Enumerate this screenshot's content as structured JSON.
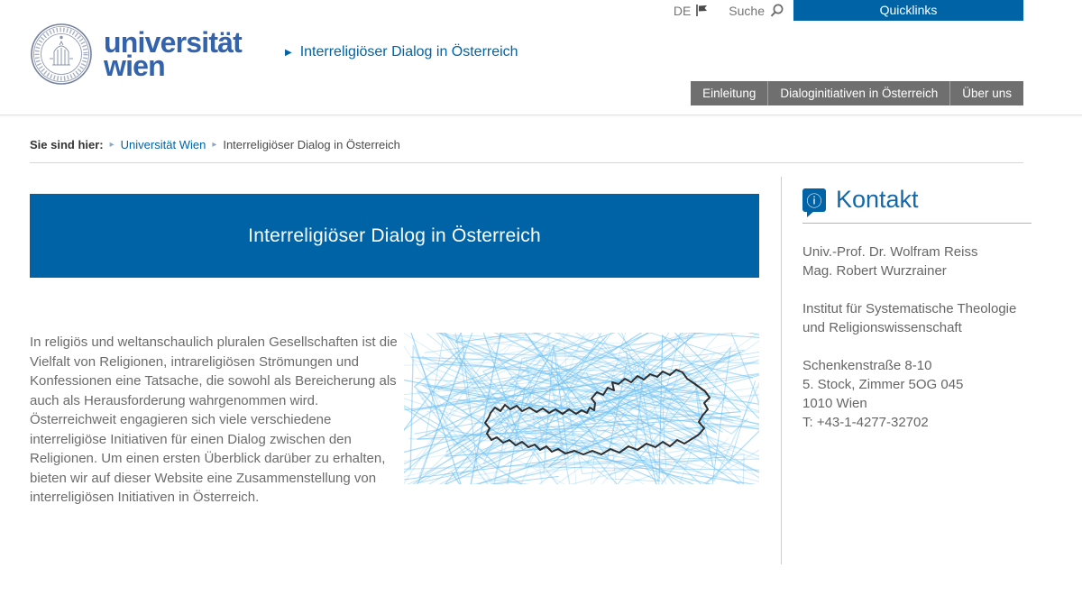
{
  "topbar": {
    "language": "DE",
    "search_label": "Suche",
    "quicklinks_label": "Quicklinks"
  },
  "header": {
    "logo": {
      "line1": "universität",
      "line2": "wien"
    },
    "site_title": "Interreligiöser Dialog in Österreich",
    "nav": [
      "Einleitung",
      "Dialoginitiativen in Österreich",
      "Über uns"
    ]
  },
  "breadcrumb": {
    "label": "Sie sind hier:",
    "items": [
      {
        "label": "Universität Wien"
      },
      {
        "label": "Interreligiöser Dialog in Österreich"
      }
    ]
  },
  "main": {
    "banner_title": "Interreligiöser Dialog in Österreich",
    "paragraph": "In religiös und weltanschaulich pluralen Gesellschaften ist die Vielfalt von Religionen, intrareligiösen Strömungen und Konfessionen eine Tatsache, die sowohl als Bereicherung als auch als Herausforderung wahrgenommen wird. Österreichweit engagieren sich viele verschiedene interreligiöse Initiativen für einen Dialog zwischen den Religionen. Um einen ersten Überblick darüber zu erhalten, bieten wir auf dieser Website eine Zusammenstellung von interreligiösen Initiativen in Österreich.",
    "map_description": "austria-outline-over-blue-scribbles"
  },
  "sidebar": {
    "heading": "Kontakt",
    "contacts": [
      "Univ.-Prof. Dr. Wolfram Reiss",
      "Mag. Robert Wurzrainer"
    ],
    "institute": [
      "Institut für Systematische Theologie",
      "und Religionswissenschaft"
    ],
    "address": [
      "Schenkenstraße 8-10",
      "5. Stock, Zimmer 5OG 045",
      "1010 Wien",
      "T: +43-1-4277-32702"
    ]
  },
  "colors": {
    "accent_blue": "#0063a6",
    "logo_blue": "#3263ac",
    "nav_gray": "#6f6f6f",
    "text_gray": "#6b6b6b",
    "scribble_blue": "#6ec1f2",
    "map_outline": "#2e2e2e"
  }
}
